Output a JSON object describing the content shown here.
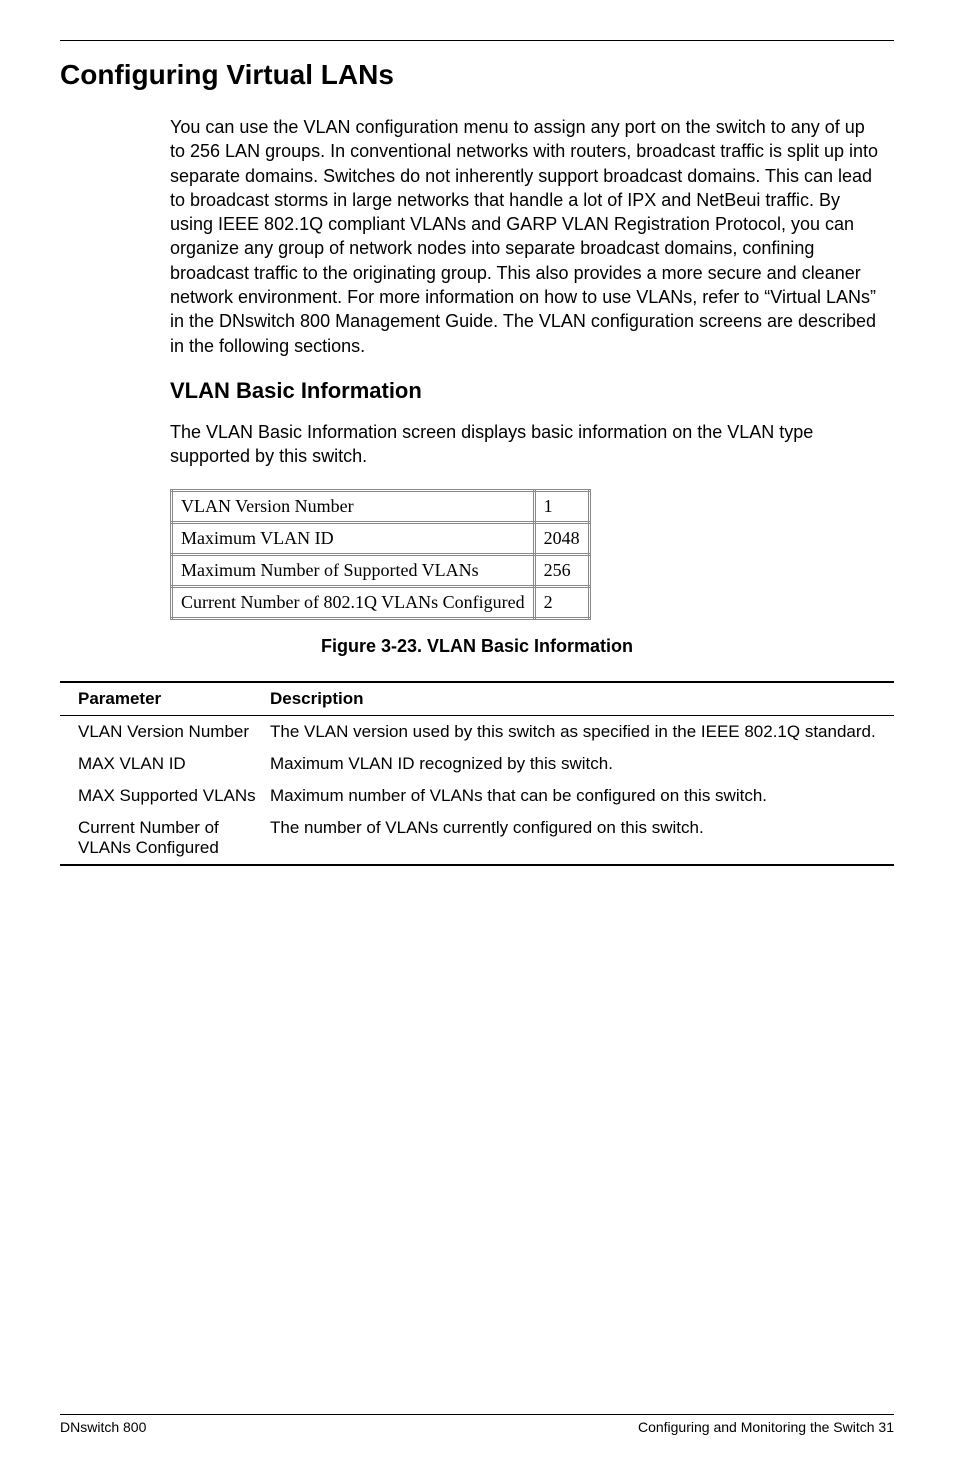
{
  "header": {
    "title": "Configuring Virtual LANs"
  },
  "intro": {
    "text": "You can use the VLAN configuration menu to assign any port on the switch to any of up to 256 LAN groups. In conventional networks with routers, broadcast traffic is split up into separate domains. Switches do not inherently support broadcast domains. This can lead to broadcast storms in large networks that handle a lot of IPX and NetBeui traffic. By using IEEE 802.1Q compliant VLANs and GARP VLAN Registration Protocol, you can organize any group of network nodes into separate broadcast domains, confining broadcast traffic to the originating group. This also provides a more secure and cleaner network environment. For more information on how to use VLANs, refer to “Virtual LANs” in the DNswitch 800 Management Guide. The VLAN configuration screens are described in the following sections."
  },
  "subsection": {
    "title": "VLAN Basic Information",
    "text": "The VLAN Basic Information screen displays basic  information on the VLAN type supported by this switch."
  },
  "info_table": {
    "rows": [
      {
        "label": "VLAN Version Number",
        "value": "1"
      },
      {
        "label": "Maximum VLAN ID",
        "value": "2048"
      },
      {
        "label": "Maximum Number of Supported VLANs",
        "value": "256"
      },
      {
        "label": "Current Number of 802.1Q VLANs Configured",
        "value": "2"
      }
    ]
  },
  "figure_caption": "Figure 3-23.  VLAN Basic Information",
  "param_table": {
    "header": {
      "param": "Parameter",
      "desc": "Description"
    },
    "rows": [
      {
        "param": "VLAN Version Number",
        "desc": "The VLAN version used by this switch as specified in the IEEE 802.1Q standard."
      },
      {
        "param": "MAX VLAN ID",
        "desc": "Maximum VLAN ID recognized by this switch."
      },
      {
        "param": "MAX Supported VLANs",
        "desc": "Maximum number of VLANs that can be configured on this switch."
      },
      {
        "param": "Current Number of VLANs Configured",
        "desc": "The number of VLANs currently configured on this switch."
      }
    ]
  },
  "footer": {
    "left": "DNswitch 800",
    "right": "Configuring and Monitoring the Switch  31"
  }
}
